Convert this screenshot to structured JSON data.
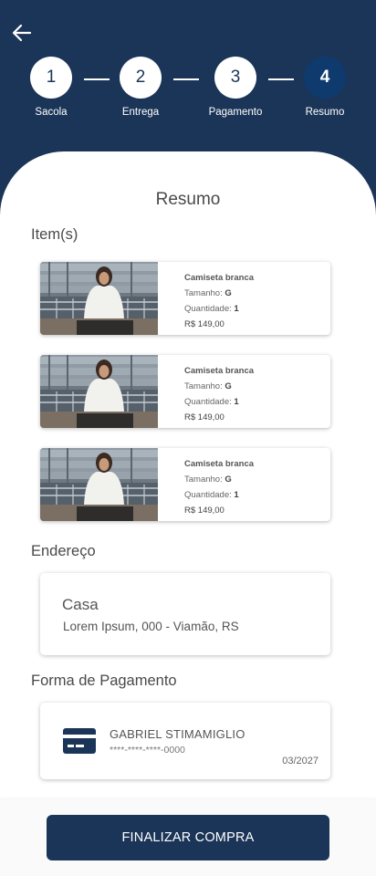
{
  "colors": {
    "primary": "#1b3558",
    "active_step": "#0f3a6e",
    "background": "#ffffff"
  },
  "header": {
    "back_icon": "arrow-left-icon",
    "steps": [
      {
        "number": "1",
        "label": "Sacola"
      },
      {
        "number": "2",
        "label": "Entrega"
      },
      {
        "number": "3",
        "label": "Pagamento"
      },
      {
        "number": "4",
        "label": "Resumo",
        "active": true
      }
    ]
  },
  "page_title": "Resumo",
  "items_section": {
    "title": "Item(s)",
    "items": [
      {
        "name": "Camiseta branca",
        "size_label": "Tamanho:",
        "size": "G",
        "quantity_label": "Quantidade:",
        "quantity": "1",
        "price": "R$ 149,00"
      },
      {
        "name": "Camiseta branca",
        "size_label": "Tamanho:",
        "size": "G",
        "quantity_label": "Quantidade:",
        "quantity": "1",
        "price": "R$ 149,00"
      },
      {
        "name": "Camiseta branca",
        "size_label": "Tamanho:",
        "size": "G",
        "quantity_label": "Quantidade:",
        "quantity": "1",
        "price": "R$ 149,00"
      }
    ]
  },
  "address_section": {
    "title": "Endereço",
    "name": "Casa",
    "line": "Lorem Ipsum, 000 - Viamão, RS"
  },
  "payment_section": {
    "title": "Forma de Pagamento",
    "card_icon": "credit-card-icon",
    "holder": "GABRIEL STIMAMIGLIO",
    "number": "****-****-****-0000",
    "expiry": "03/2027"
  },
  "footer": {
    "finish_label": "FINALIZAR COMPRA"
  }
}
